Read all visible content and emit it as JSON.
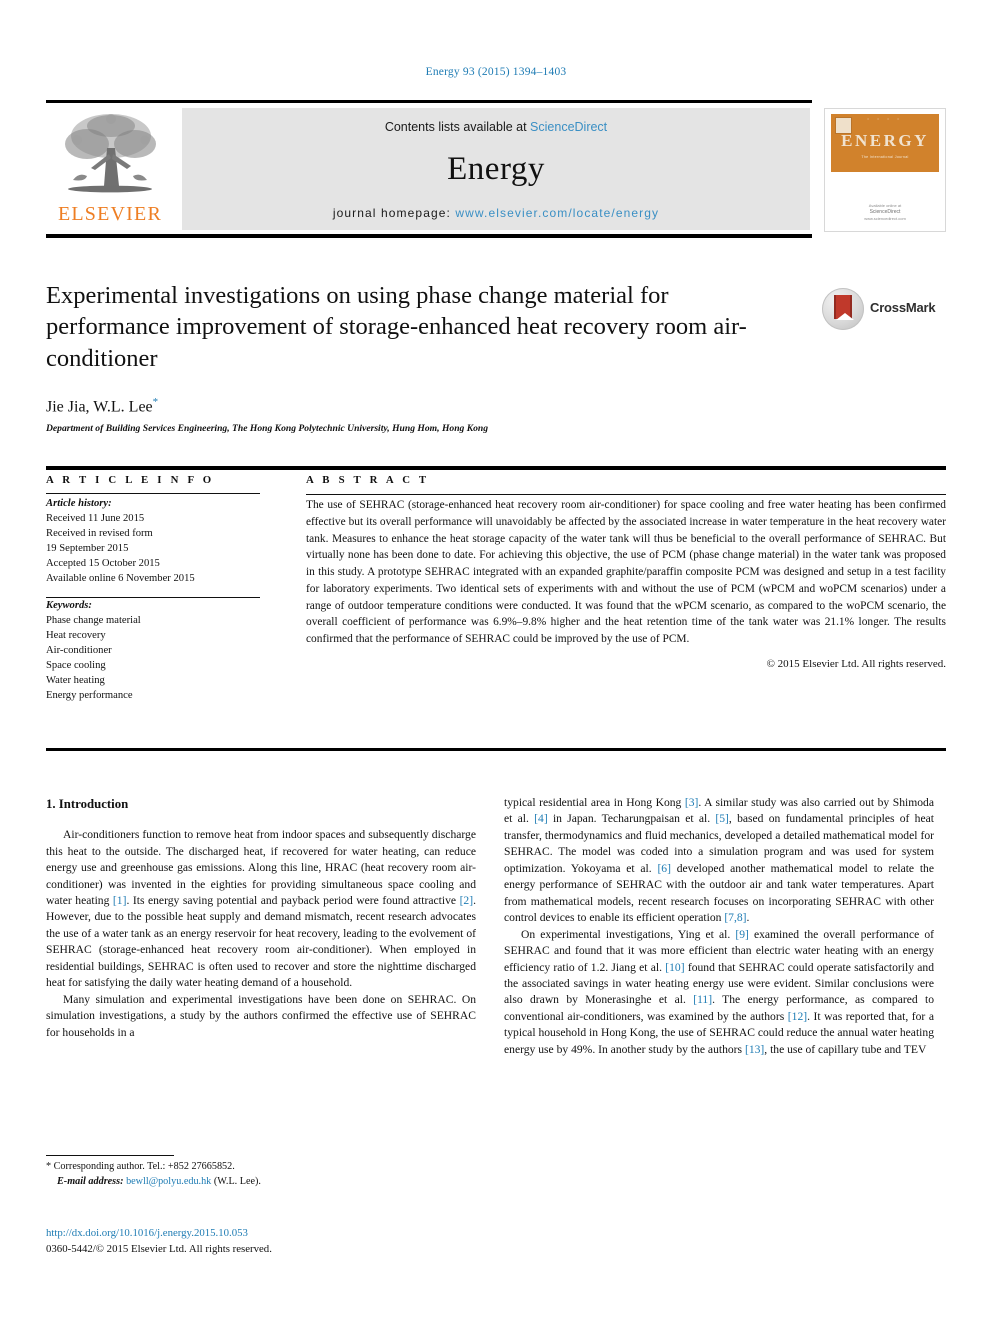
{
  "running_head": "Energy 93 (2015) 1394–1403",
  "masthead": {
    "publisher_name": "ELSEVIER",
    "contents_prefix": "Contents lists available at ",
    "contents_link": "ScienceDirect",
    "journal_name": "Energy",
    "homepage_prefix": "journal homepage: ",
    "homepage_url": "www.elsevier.com/locate/energy",
    "cover": {
      "title": "ENERGY",
      "tagline": "The International Journal",
      "top_marks": "• • • •",
      "footer_line1": "Available online at",
      "footer_line2": "ScienceDirect",
      "footer_line3": "www.sciencedirect.com"
    }
  },
  "article": {
    "title": "Experimental investigations on using phase change material for performance improvement of storage-enhanced heat recovery room air-conditioner",
    "authors": "Jie Jia, W.L. Lee",
    "corresponding_marker": "*",
    "affiliation": "Department of Building Services Engineering, The Hong Kong Polytechnic University, Hung Hom, Hong Kong",
    "crossmark_label": "CrossMark"
  },
  "article_info": {
    "heading": "A R T I C L E   I N F O",
    "history_label": "Article history:",
    "history": [
      "Received 11 June 2015",
      "Received in revised form",
      "19 September 2015",
      "Accepted 15 October 2015",
      "Available online 6 November 2015"
    ],
    "keywords_label": "Keywords:",
    "keywords": [
      "Phase change material",
      "Heat recovery",
      "Air-conditioner",
      "Space cooling",
      "Water heating",
      "Energy performance"
    ]
  },
  "abstract": {
    "heading": "A B S T R A C T",
    "text": "The use of SEHRAC (storage-enhanced heat recovery room air-conditioner) for space cooling and free water heating has been confirmed effective but its overall performance will unavoidably be affected by the associated increase in water temperature in the heat recovery water tank. Measures to enhance the heat storage capacity of the water tank will thus be beneficial to the overall performance of SEHRAC. But virtually none has been done to date. For achieving this objective, the use of PCM (phase change material) in the water tank was proposed in this study. A prototype SEHRAC integrated with an expanded graphite/paraffin composite PCM was designed and setup in a test facility for laboratory experiments. Two identical sets of experiments with and without the use of PCM (wPCM and woPCM scenarios) under a range of outdoor temperature conditions were conducted. It was found that the wPCM scenario, as compared to the woPCM scenario, the overall coefficient of performance was 6.9%–9.8% higher and the heat retention time of the tank water was 21.1% longer. The results confirmed that the performance of SEHRAC could be improved by the use of PCM.",
    "copyright": "© 2015 Elsevier Ltd. All rights reserved."
  },
  "introduction": {
    "heading": "1. Introduction",
    "left_paragraphs": [
      "Air-conditioners function to remove heat from indoor spaces and subsequently discharge this heat to the outside. The discharged heat, if recovered for water heating, can reduce energy use and greenhouse gas emissions. Along this line, HRAC (heat recovery room air-conditioner) was invented in the eighties for providing simultaneous space cooling and water heating [1]. Its energy saving potential and payback period were found attractive [2]. However, due to the possible heat supply and demand mismatch, recent research advocates the use of a water tank as an energy reservoir for heat recovery, leading to the evolvement of SEHRAC (storage-enhanced heat recovery room air-conditioner). When employed in residential buildings, SEHRAC is often used to recover and store the nighttime discharged heat for satisfying the daily water heating demand of a household.",
      "Many simulation and experimental investigations have been done on SEHRAC. On simulation investigations, a study by the authors confirmed the effective use of SEHRAC for households in a"
    ],
    "right_paragraphs": [
      "typical residential area in Hong Kong [3]. A similar study was also carried out by Shimoda et al. [4] in Japan. Techarungpaisan et al. [5], based on fundamental principles of heat transfer, thermodynamics and fluid mechanics, developed a detailed mathematical model for SEHRAC. The model was coded into a simulation program and was used for system optimization. Yokoyama et al. [6] developed another mathematical model to relate the energy performance of SEHRAC with the outdoor air and tank water temperatures. Apart from mathematical models, recent research focuses on incorporating SEHRAC with other control devices to enable its efficient operation [7,8].",
      "On experimental investigations, Ying et al. [9] examined the overall performance of SEHRAC and found that it was more efficient than electric water heating with an energy efficiency ratio of 1.2. Jiang et al. [10] found that SEHRAC could operate satisfactorily and the associated savings in water heating energy use were evident. Similar conclusions were also drawn by Monerasinghe et al. [11]. The energy performance, as compared to conventional air-conditioners, was examined by the authors [12]. It was reported that, for a typical household in Hong Kong, the use of SEHRAC could reduce the annual water heating energy use by 49%. In another study by the authors [13], the use of capillary tube and TEV"
    ]
  },
  "footnote": {
    "corresponding": "* Corresponding author. Tel.: +852 27665852.",
    "email_label": "E-mail address:",
    "email": "bewll@polyu.edu.hk",
    "email_suffix": "(W.L. Lee).",
    "doi": "http://dx.doi.org/10.1016/j.energy.2015.10.053",
    "issn_line": "0360-5442/© 2015 Elsevier Ltd. All rights reserved."
  },
  "colors": {
    "link": "#1f7cb4",
    "elsevier_orange": "#ee7e23",
    "sciencedirect": "#3a8fc4"
  }
}
